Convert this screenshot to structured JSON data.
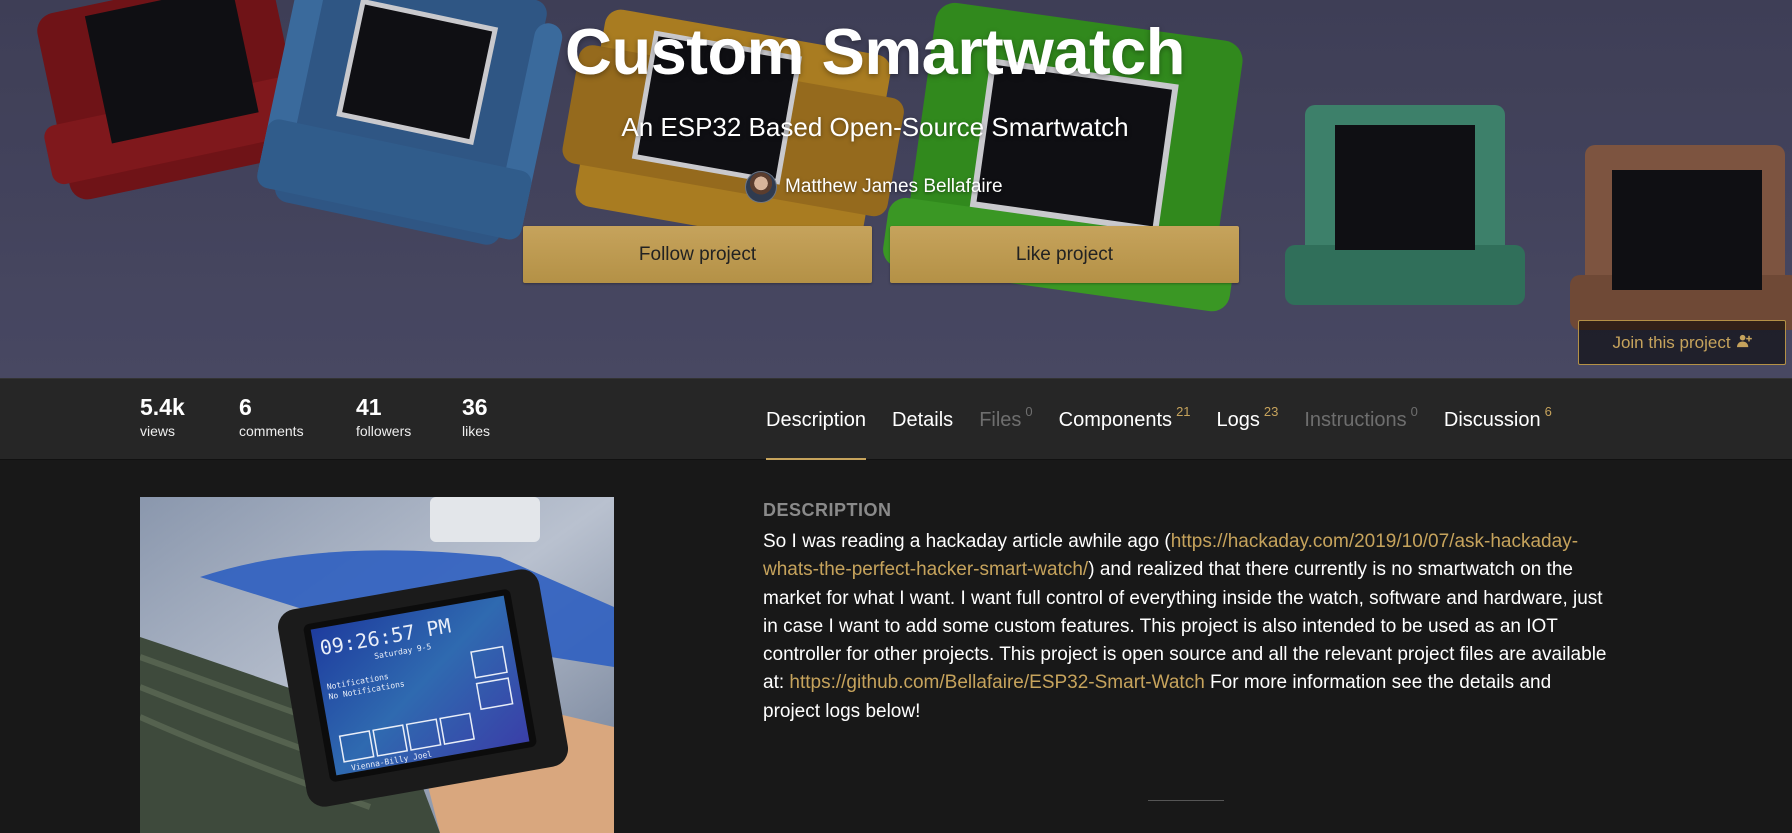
{
  "hero": {
    "title": "Custom Smartwatch",
    "subtitle": "An ESP32 Based Open-Source Smartwatch",
    "author": "Matthew James Bellafaire",
    "follow_label": "Follow project",
    "like_label": "Like project",
    "join_label": "Join this project",
    "join_icon": "user-plus-icon"
  },
  "stats": [
    {
      "value": "5.4k",
      "label": "views"
    },
    {
      "value": "6",
      "label": "comments"
    },
    {
      "value": "41",
      "label": "followers"
    },
    {
      "value": "36",
      "label": "likes"
    }
  ],
  "tabs": [
    {
      "label": "Description",
      "count": "",
      "state": "active"
    },
    {
      "label": "Details",
      "count": "",
      "state": "normal"
    },
    {
      "label": "Files",
      "count": "0",
      "state": "disabled"
    },
    {
      "label": "Components",
      "count": "21",
      "state": "normal"
    },
    {
      "label": "Logs",
      "count": "23",
      "state": "normal"
    },
    {
      "label": "Instructions",
      "count": "0",
      "state": "disabled"
    },
    {
      "label": "Discussion",
      "count": "6",
      "state": "normal"
    }
  ],
  "description": {
    "heading": "DESCRIPTION",
    "text_1": "So I was reading a hackaday article awhile ago (",
    "link_1": "https://hackaday.com/2019/10/07/ask-hackaday-whats-the-perfect-hacker-smart-watch/",
    "text_2": ") and realized that there currently is no smartwatch on the market for what I want. I want full control of everything inside the watch, software and hardware, just in case I want to add some custom features. This project is also intended to be used as an IOT controller for other projects. This project is open source and all the relevant project files are available at: ",
    "link_2": "https://github.com/Bellafaire/ESP32-Smart-Watch",
    "text_3": " For more information see the details and project logs below!"
  },
  "photo": {
    "screen_time": "09:26:57 PM",
    "screen_day": "Saturday 9-5",
    "screen_notif_1": "Notifications",
    "screen_notif_2": "No Notifications",
    "screen_track": "Vienna-Billy Joel"
  },
  "colors": {
    "accent": "#c6a35c",
    "hero_bg": "#45455f",
    "statsbar_bg": "#262626",
    "page_bg": "#181818",
    "disabled_text": "#6e6e6e"
  }
}
